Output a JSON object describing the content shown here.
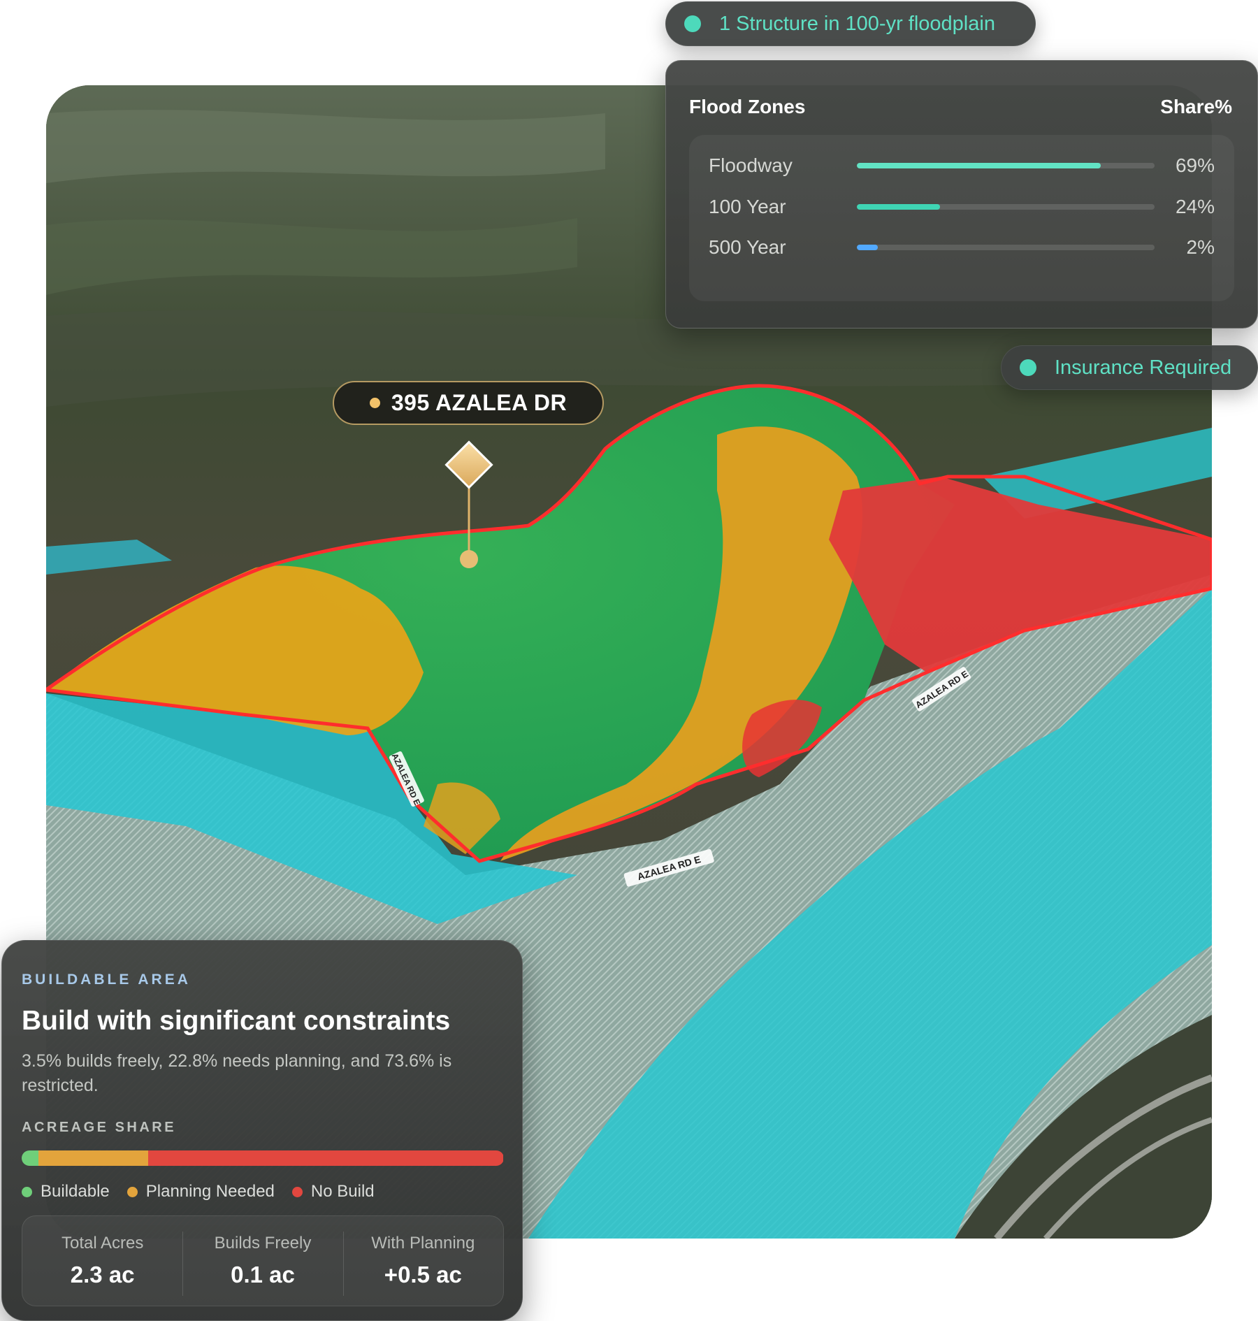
{
  "status_pills": {
    "structure": "1 Structure in 100-yr floodplain",
    "insurance": "Insurance Required"
  },
  "flood_zones": {
    "title": "Flood Zones",
    "share_header": "Share%",
    "rows": [
      {
        "label": "Floodway",
        "pct_text": "69%",
        "fill_fraction": 0.82,
        "color": "#62e3c4"
      },
      {
        "label": "100 Year",
        "pct_text": "24%",
        "fill_fraction": 0.28,
        "color": "#3fd5b4"
      },
      {
        "label": "500 Year",
        "pct_text": "2%",
        "fill_fraction": 0.07,
        "color": "#52a9ff"
      }
    ]
  },
  "map": {
    "address": "395 AZALEA DR",
    "road_labels": [
      "AZALEA RD E",
      "AZALEA RD E",
      "AZALEA RD E"
    ]
  },
  "buildable_area": {
    "eyebrow": "BUILDABLE AREA",
    "title": "Build with significant constraints",
    "description": "3.5% builds freely, 22.8% needs planning, and 73.6% is restricted.",
    "acreage_label": "ACREAGE SHARE",
    "share_segments": [
      {
        "name": "Buildable",
        "percent": 3.5,
        "color": "#6fcf7a"
      },
      {
        "name": "Planning Needed",
        "percent": 22.8,
        "color": "#e3a43c"
      },
      {
        "name": "No Build",
        "percent": 73.6,
        "color": "#e2473f"
      }
    ],
    "legend": [
      {
        "label": "Buildable",
        "color": "#6fcf7a"
      },
      {
        "label": "Planning Needed",
        "color": "#e3a43c"
      },
      {
        "label": "No Build",
        "color": "#e2473f"
      }
    ],
    "stats": [
      {
        "label": "Total Acres",
        "value": "2.3 ac"
      },
      {
        "label": "Builds Freely",
        "value": "0.1 ac"
      },
      {
        "label": "With Planning",
        "value": "+0.5 ac"
      }
    ]
  }
}
